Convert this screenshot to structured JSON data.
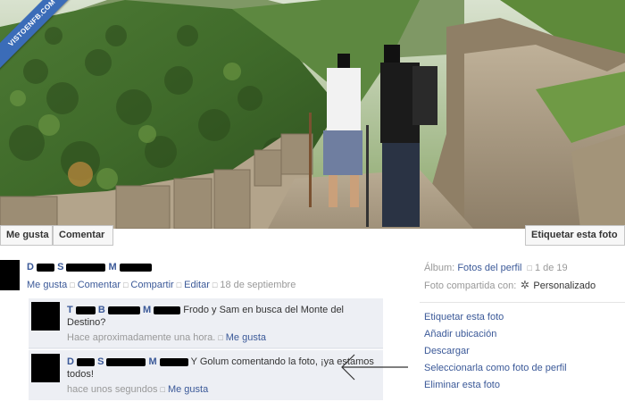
{
  "watermark": "VISTOENFB.COM",
  "photo": {
    "alt": "Two hikers on a mountain trail"
  },
  "actions": {
    "like": "Me gusta",
    "comment": "Comentar",
    "tag": "Etiquetar esta foto"
  },
  "post": {
    "author_initial_1": "D",
    "author_initial_2": "S",
    "author_initial_3": "M",
    "meta": {
      "like": "Me gusta",
      "comment": "Comentar",
      "share": "Compartir",
      "edit": "Editar",
      "date": "18 de septiembre"
    }
  },
  "comments": [
    {
      "initial_1": "T",
      "initial_2": "B",
      "initial_3": "M",
      "text": "Frodo y Sam en busca del Monte del Destino?",
      "time": "Hace aproximadamente una hora.",
      "like": "Me gusta"
    },
    {
      "initial_1": "D",
      "initial_2": "S",
      "initial_3": "M",
      "text": "Y Golum comentando la foto, ¡ya estamos todos!",
      "time": "hace unos segundos",
      "like": "Me gusta"
    }
  ],
  "sidebar": {
    "album_label": "Álbum:",
    "album_name": "Fotos del perfil",
    "album_position": "1 de 19",
    "shared_label": "Foto compartida con:",
    "shared_icon": "gear-icon",
    "shared_value": "Personalizado",
    "actions": [
      "Etiquetar esta foto",
      "Añadir ubicación",
      "Descargar",
      "Seleccionarla como foto de perfil",
      "Eliminar esta foto"
    ]
  },
  "colors": {
    "link": "#3b5998",
    "comment_bg": "#edeff4",
    "muted": "#999999",
    "watermark": "#3b6cb8"
  }
}
